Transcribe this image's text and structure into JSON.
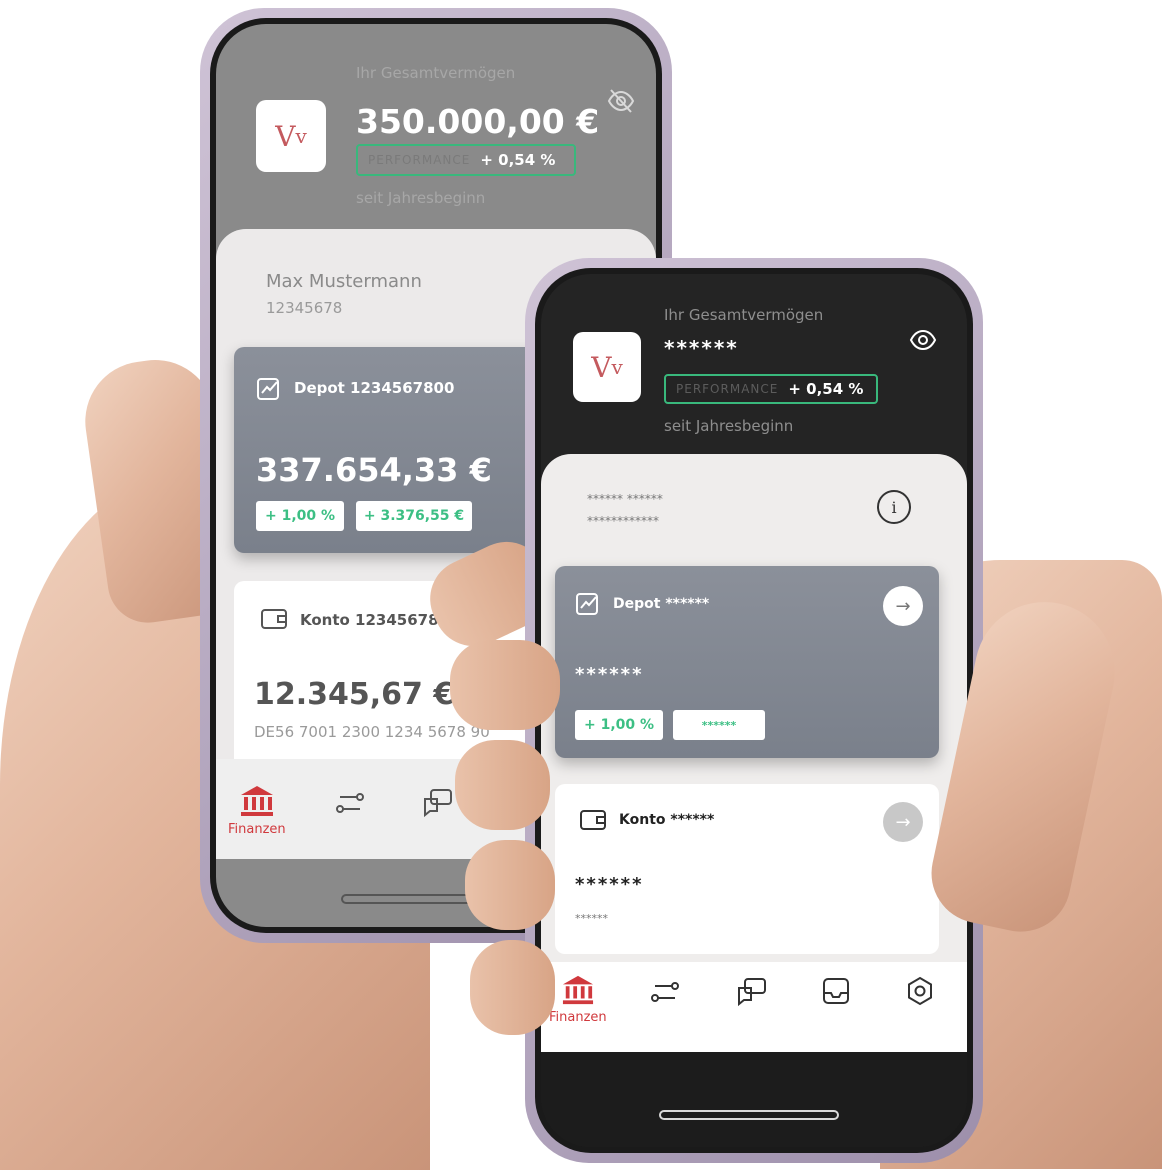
{
  "colors": {
    "accent_red": "#d0393d",
    "positive_green": "#39b87c",
    "dark_header": "#242424",
    "card_grey": "#858a94"
  },
  "back_phone": {
    "header_label": "Ihr Gesamtvermögen",
    "total_amount": "350.000,00 €",
    "performance_label": "PERFORMANCE",
    "performance_value": "+ 0,54 %",
    "since_label": "seit Jahresbeginn",
    "visibility_icon": "eye-off-icon",
    "user_name": "Max Mustermann",
    "user_id": "12345678",
    "depot": {
      "title": "Depot 1234567800",
      "amount": "337.654,33 €",
      "change_percent": "+ 1,00 %",
      "change_amount": "+ 3.376,55 €"
    },
    "konto": {
      "title": "Konto 12345678900",
      "amount": "12.345,67 €",
      "iban": "DE56 7001 2300 1234 5678 90"
    },
    "nav": {
      "active_label": "Finanzen"
    }
  },
  "front_phone": {
    "header_label": "Ihr Gesamtvermögen",
    "total_amount": "******",
    "performance_label": "PERFORMANCE",
    "performance_value": "+ 0,54 %",
    "since_label": "seit Jahresbeginn",
    "visibility_icon": "eye-icon",
    "user_name_masked": "****** ******",
    "user_id_masked": "************",
    "depot": {
      "title": "Depot ******",
      "amount": "******",
      "change_percent": "+ 1,00 %",
      "change_amount": "******"
    },
    "konto": {
      "title": "Konto ******",
      "amount": "******",
      "iban": "******"
    },
    "nav": {
      "active_label": "Finanzen",
      "items": [
        "bank-icon",
        "transfer-icon",
        "chat-icon",
        "inbox-icon",
        "settings-icon"
      ]
    }
  }
}
